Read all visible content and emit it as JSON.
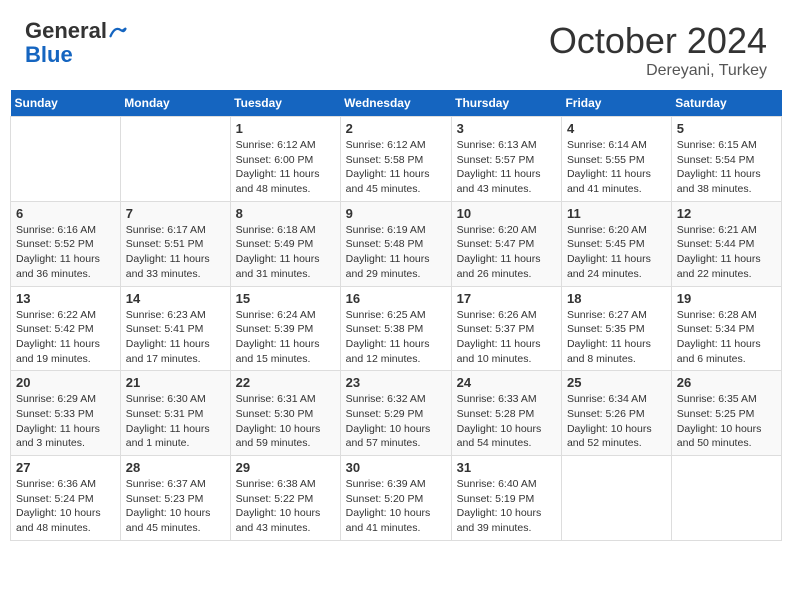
{
  "header": {
    "logo": {
      "general": "General",
      "blue": "Blue"
    },
    "title": "October 2024",
    "location": "Dereyani, Turkey"
  },
  "columns": [
    "Sunday",
    "Monday",
    "Tuesday",
    "Wednesday",
    "Thursday",
    "Friday",
    "Saturday"
  ],
  "weeks": [
    [
      {
        "day": "",
        "info": ""
      },
      {
        "day": "",
        "info": ""
      },
      {
        "day": "1",
        "sunrise": "6:12 AM",
        "sunset": "6:00 PM",
        "daylight": "11 hours and 48 minutes."
      },
      {
        "day": "2",
        "sunrise": "6:12 AM",
        "sunset": "5:58 PM",
        "daylight": "11 hours and 45 minutes."
      },
      {
        "day": "3",
        "sunrise": "6:13 AM",
        "sunset": "5:57 PM",
        "daylight": "11 hours and 43 minutes."
      },
      {
        "day": "4",
        "sunrise": "6:14 AM",
        "sunset": "5:55 PM",
        "daylight": "11 hours and 41 minutes."
      },
      {
        "day": "5",
        "sunrise": "6:15 AM",
        "sunset": "5:54 PM",
        "daylight": "11 hours and 38 minutes."
      }
    ],
    [
      {
        "day": "6",
        "sunrise": "6:16 AM",
        "sunset": "5:52 PM",
        "daylight": "11 hours and 36 minutes."
      },
      {
        "day": "7",
        "sunrise": "6:17 AM",
        "sunset": "5:51 PM",
        "daylight": "11 hours and 33 minutes."
      },
      {
        "day": "8",
        "sunrise": "6:18 AM",
        "sunset": "5:49 PM",
        "daylight": "11 hours and 31 minutes."
      },
      {
        "day": "9",
        "sunrise": "6:19 AM",
        "sunset": "5:48 PM",
        "daylight": "11 hours and 29 minutes."
      },
      {
        "day": "10",
        "sunrise": "6:20 AM",
        "sunset": "5:47 PM",
        "daylight": "11 hours and 26 minutes."
      },
      {
        "day": "11",
        "sunrise": "6:20 AM",
        "sunset": "5:45 PM",
        "daylight": "11 hours and 24 minutes."
      },
      {
        "day": "12",
        "sunrise": "6:21 AM",
        "sunset": "5:44 PM",
        "daylight": "11 hours and 22 minutes."
      }
    ],
    [
      {
        "day": "13",
        "sunrise": "6:22 AM",
        "sunset": "5:42 PM",
        "daylight": "11 hours and 19 minutes."
      },
      {
        "day": "14",
        "sunrise": "6:23 AM",
        "sunset": "5:41 PM",
        "daylight": "11 hours and 17 minutes."
      },
      {
        "day": "15",
        "sunrise": "6:24 AM",
        "sunset": "5:39 PM",
        "daylight": "11 hours and 15 minutes."
      },
      {
        "day": "16",
        "sunrise": "6:25 AM",
        "sunset": "5:38 PM",
        "daylight": "11 hours and 12 minutes."
      },
      {
        "day": "17",
        "sunrise": "6:26 AM",
        "sunset": "5:37 PM",
        "daylight": "11 hours and 10 minutes."
      },
      {
        "day": "18",
        "sunrise": "6:27 AM",
        "sunset": "5:35 PM",
        "daylight": "11 hours and 8 minutes."
      },
      {
        "day": "19",
        "sunrise": "6:28 AM",
        "sunset": "5:34 PM",
        "daylight": "11 hours and 6 minutes."
      }
    ],
    [
      {
        "day": "20",
        "sunrise": "6:29 AM",
        "sunset": "5:33 PM",
        "daylight": "11 hours and 3 minutes."
      },
      {
        "day": "21",
        "sunrise": "6:30 AM",
        "sunset": "5:31 PM",
        "daylight": "11 hours and 1 minute."
      },
      {
        "day": "22",
        "sunrise": "6:31 AM",
        "sunset": "5:30 PM",
        "daylight": "10 hours and 59 minutes."
      },
      {
        "day": "23",
        "sunrise": "6:32 AM",
        "sunset": "5:29 PM",
        "daylight": "10 hours and 57 minutes."
      },
      {
        "day": "24",
        "sunrise": "6:33 AM",
        "sunset": "5:28 PM",
        "daylight": "10 hours and 54 minutes."
      },
      {
        "day": "25",
        "sunrise": "6:34 AM",
        "sunset": "5:26 PM",
        "daylight": "10 hours and 52 minutes."
      },
      {
        "day": "26",
        "sunrise": "6:35 AM",
        "sunset": "5:25 PM",
        "daylight": "10 hours and 50 minutes."
      }
    ],
    [
      {
        "day": "27",
        "sunrise": "6:36 AM",
        "sunset": "5:24 PM",
        "daylight": "10 hours and 48 minutes."
      },
      {
        "day": "28",
        "sunrise": "6:37 AM",
        "sunset": "5:23 PM",
        "daylight": "10 hours and 45 minutes."
      },
      {
        "day": "29",
        "sunrise": "6:38 AM",
        "sunset": "5:22 PM",
        "daylight": "10 hours and 43 minutes."
      },
      {
        "day": "30",
        "sunrise": "6:39 AM",
        "sunset": "5:20 PM",
        "daylight": "10 hours and 41 minutes."
      },
      {
        "day": "31",
        "sunrise": "6:40 AM",
        "sunset": "5:19 PM",
        "daylight": "10 hours and 39 minutes."
      },
      {
        "day": "",
        "info": ""
      },
      {
        "day": "",
        "info": ""
      }
    ]
  ],
  "labels": {
    "sunrise": "Sunrise:",
    "sunset": "Sunset:",
    "daylight": "Daylight:"
  }
}
